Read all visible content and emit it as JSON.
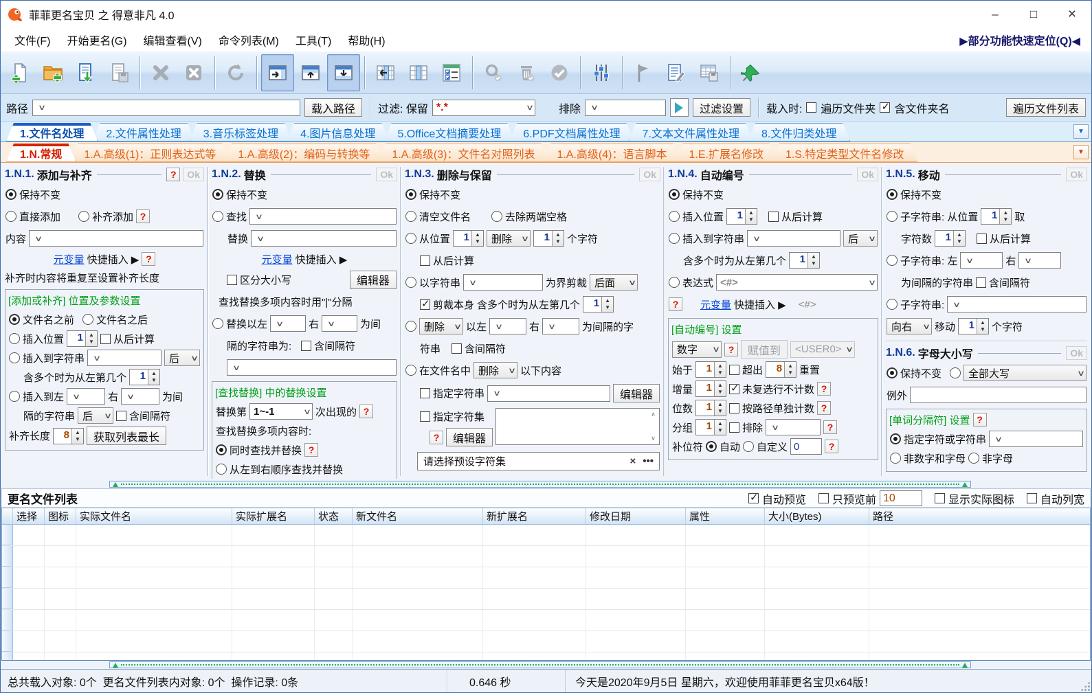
{
  "window": {
    "title": "菲菲更名宝贝 之 得意非凡 4.0",
    "minimize": "–",
    "maximize": "□",
    "close": "×"
  },
  "menu": {
    "items": [
      "文件(F)",
      "开始更名(G)",
      "编辑查看(V)",
      "命令列表(M)",
      "工具(T)",
      "帮助(H)"
    ],
    "quick_locate": "▶部分功能快速定位(Q)◀"
  },
  "toolbar": {
    "icons": [
      "new-file",
      "add-folder",
      "import-list",
      "save-list",
      "delete",
      "delete-all",
      "refresh",
      "panel-right",
      "panel-top",
      "panel-bottom",
      "column-move-left",
      "column-layout",
      "check-options",
      "search",
      "clear-filtered",
      "apply-selected",
      "tune-settings",
      "flag-mark",
      "edit-log",
      "export-table",
      "pin-window"
    ]
  },
  "pathbar": {
    "path_label": "路径",
    "load_path": "载入路径",
    "filter_label": "过滤: 保留",
    "filter_value": "*.*",
    "exclude_label": "排除",
    "filter_settings": "过滤设置",
    "load_when": "载入时:",
    "traverse_folders": "遍历文件夹",
    "include_folder_name": "含文件夹名",
    "traverse_list": "遍历文件列表"
  },
  "tabs": {
    "main": [
      "1.文件名处理",
      "2.文件属性处理",
      "3.音乐标签处理",
      "4.图片信息处理",
      "5.Office文档摘要处理",
      "6.PDF文档属性处理",
      "7.文本文件属性处理",
      "8.文件归类处理"
    ],
    "main_active": 0,
    "sub": [
      "1.N.常规",
      "1.A.高级(1)：正则表达式等",
      "1.A.高级(2)：编码与转换等",
      "1.A.高级(3)：文件名对照列表",
      "1.A.高级(4)：语言脚本",
      "1.E.扩展名修改",
      "1.S.特定类型文件名修改"
    ],
    "sub_active": 0
  },
  "p1": {
    "num": "1.N.1.",
    "name": "添加与补齐",
    "help": "?",
    "ok": "Ok",
    "keep": "保持不变",
    "direct": "直接添加",
    "pad": "补齐添加",
    "pad_help": "?",
    "content_label": "内容",
    "meta_link": "元变量",
    "quick_insert": "快捷插入 ▶",
    "quick_help": "?",
    "note": "补齐时内容将重复至设置补齐长度",
    "group_title": "[添加或补齐] 位置及参数设置",
    "before_name": "文件名之前",
    "after_name": "文件名之后",
    "insert_pos": "插入位置",
    "insert_pos_value": "1",
    "from_end": "从后计算",
    "insert_to_string": "插入到字符串",
    "after_dd": "后",
    "multi_label": "含多个时为从左第几个",
    "multi_value": "1",
    "insert_left": "插入到左",
    "right_label": "右",
    "as_sep1": "为间",
    "as_sep2": "隔的字符串",
    "after_dd2": "后",
    "include_sep": "含间隔符",
    "pad_len_label": "补齐长度",
    "pad_len_value": "8",
    "get_longest": "获取列表最长"
  },
  "p2": {
    "num": "1.N.2.",
    "name": "替换",
    "ok": "Ok",
    "keep": "保持不变",
    "find": "查找",
    "replace": "替换",
    "meta_link": "元变量",
    "quick_insert": "快捷插入 ▶",
    "case_sensitive": "区分大小写",
    "editor": "编辑器",
    "multi_note": "查找替换多项内容时用\"|\"分隔",
    "replace_between": "替换以左",
    "right_label": "右",
    "as_sep1": "为间",
    "as_sep2": "隔的字符串为:",
    "include_sep": "含间隔符",
    "group_title": "[查找替换] 中的替换设置",
    "replace_nth": "替换第",
    "nth_value": "1~-1",
    "occurrence": "次出现的",
    "help": "?",
    "multi_when": "查找替换多项内容时:",
    "simultaneous": "同时查找并替换",
    "sim_help": "?",
    "sequential": "从左到右顺序查找并替换"
  },
  "p3": {
    "num": "1.N.3.",
    "name": "删除与保留",
    "ok": "Ok",
    "keep": "保持不变",
    "clear_name": "清空文件名",
    "trim_spaces": "去除两端空格",
    "from_pos": "从位置",
    "pos_value": "1",
    "delete_dd": "删除",
    "count_value": "1",
    "chars": "个字符",
    "from_end": "从后计算",
    "by_string": "以字符串",
    "cut_bound": "为界剪裁",
    "back_dd": "后面",
    "cut_self": "剪裁本身",
    "multi_label": "含多个时为从左第几个",
    "multi_value": "1",
    "delete_dd2": "删除",
    "between_left": "以左",
    "right_label": "右",
    "as_sep1": "为间隔的字",
    "as_sep2": "符串",
    "include_sep": "含间隔符",
    "in_name": "在文件名中",
    "delete_dd3": "删除",
    "following": "以下内容",
    "spec_string": "指定字符串",
    "editor": "编辑器",
    "spec_charset": "指定字符集",
    "help": "?",
    "editor2": "编辑器",
    "preset_placeholder": "请选择预设字符集",
    "clear_x": "×",
    "more": "•••"
  },
  "p4": {
    "num": "1.N.4.",
    "name": "自动编号",
    "ok": "Ok",
    "keep": "保持不变",
    "insert_pos": "插入位置",
    "pos_value": "1",
    "from_end": "从后计算",
    "insert_to_string": "插入到字符串",
    "after_dd": "后",
    "multi_label": "含多个时为从左第几个",
    "multi_value": "1",
    "expression": "表达式",
    "expr_value": "<#>",
    "help": "?",
    "meta_link": "元变量",
    "quick_insert": "快捷插入 ▶",
    "expr_tag": "<#>",
    "group_title": "[自动编号] 设置",
    "number_dd": "数字",
    "num_help": "?",
    "assign_to": "赋值到",
    "user_var": "<USER0>",
    "start_label": "始于",
    "start_value": "1",
    "exceed": "超出",
    "exceed_value": "8",
    "reset": "重置",
    "increment": "增量",
    "inc_value": "1",
    "skip_unchecked": "未复选行不计数",
    "skip_help": "?",
    "digits": "位数",
    "digits_value": "1",
    "per_path": "按路径单独计数",
    "path_help": "?",
    "group_label": "分组",
    "group_value": "1",
    "exclude": "排除",
    "excl_help": "?",
    "pad_char": "补位符",
    "auto": "自动",
    "custom": "自定义",
    "custom_value": "0",
    "custom_help": "?"
  },
  "p5": {
    "num": "1.N.5.",
    "name": "移动",
    "ok": "Ok",
    "keep": "保持不变",
    "sub_from": "子字符串: 从位置",
    "from_value": "1",
    "take": "取",
    "char_count": "字符数",
    "count_value": "1",
    "from_end": "从后计算",
    "sub_between": "子字符串: 左",
    "right_label": "右",
    "as_sep": "为间隔的字符串",
    "include_sep": "含间隔符",
    "sub_string": "子字符串:",
    "dir_dd": "向右",
    "move": "移动",
    "move_value": "1",
    "chars": "个字符"
  },
  "p6": {
    "num": "1.N.6.",
    "name": "字母大小写",
    "ok": "Ok",
    "keep": "保持不变",
    "case_dd": "全部大写",
    "except": "例外",
    "group_title": "[单词分隔符] 设置",
    "group_help": "?",
    "spec_chars": "指定字符或字符串",
    "non_alnum": "非数字和字母",
    "non_alpha": "非字母"
  },
  "filelist": {
    "title": "更名文件列表",
    "auto_preview": "自动预览",
    "preview_first": "只预览前",
    "preview_count": "10",
    "show_real_icons": "显示实际图标",
    "auto_col_width": "自动列宽",
    "columns": [
      "选择",
      "图标",
      "实际文件名",
      "实际扩展名",
      "状态",
      "新文件名",
      "新扩展名",
      "修改日期",
      "属性",
      "大小(Bytes)",
      "路径"
    ],
    "rows": []
  },
  "statusbar": {
    "loaded": "总共载入对象: 0个  更名文件列表内对象: 0个  操作记录: 0条",
    "time": "0.646 秒",
    "welcome": "今天是2020年9月5日 星期六，欢迎使用菲菲更名宝贝x64版！"
  },
  "colors": {
    "accent_blue": "#1d5fc4",
    "accent_orange": "#e2621c",
    "active_red": "#d62400",
    "green_label": "#00a018",
    "link_blue": "#0040d8",
    "splitter_green": "#1fb14b"
  }
}
